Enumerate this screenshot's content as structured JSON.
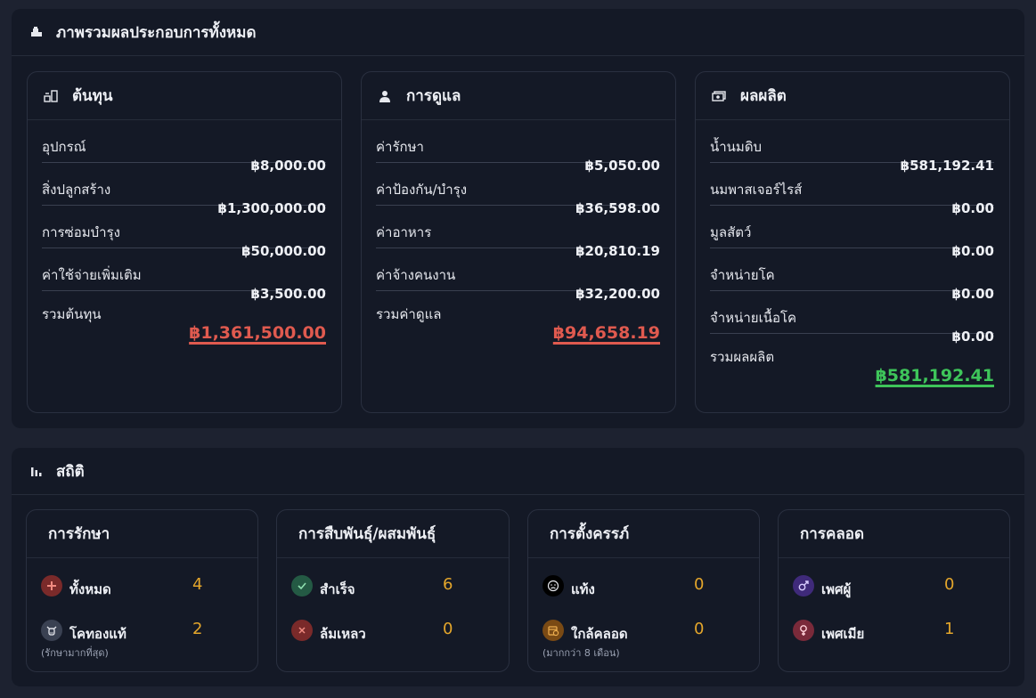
{
  "overview": {
    "title": "ภาพรวมผลประกอบการทั้งหมด",
    "cards": [
      {
        "title": "ต้นทุน",
        "icon": "cash-register-icon",
        "rows": [
          {
            "label": "อุปกรณ์",
            "value": "฿8,000.00"
          },
          {
            "label": "สิ่งปลูกสร้าง",
            "value": "฿1,300,000.00"
          },
          {
            "label": "การซ่อมบำรุง",
            "value": "฿50,000.00"
          },
          {
            "label": "ค่าใช้จ่ายเพิ่มเติม",
            "value": "฿3,500.00"
          }
        ],
        "total_label": "รวมต้นทุน",
        "total_value": "฿1,361,500.00"
      },
      {
        "title": "การดูแล",
        "icon": "user-doctor-icon",
        "rows": [
          {
            "label": "ค่ารักษา",
            "value": "฿5,050.00"
          },
          {
            "label": "ค่าป้องกัน/บำรุง",
            "value": "฿36,598.00"
          },
          {
            "label": "ค่าอาหาร",
            "value": "฿20,810.19"
          },
          {
            "label": "ค่าจ้างคนงาน",
            "value": "฿32,200.00"
          }
        ],
        "total_label": "รวมค่าดูแล",
        "total_value": "฿94,658.19"
      },
      {
        "title": "ผลผลิต",
        "icon": "money-bill-icon",
        "rows": [
          {
            "label": "น้ำนมดิบ",
            "value": "฿581,192.41"
          },
          {
            "label": "นมพาสเจอร์ไรส์",
            "value": "฿0.00"
          },
          {
            "label": "มูลสัตว์",
            "value": "฿0.00"
          },
          {
            "label": "จำหน่ายโค",
            "value": "฿0.00"
          },
          {
            "label": "จำหน่ายเนื้อโค",
            "value": "฿0.00"
          }
        ],
        "total_label": "รวมผลผลิต",
        "total_value": "฿581,192.41"
      }
    ]
  },
  "statistics": {
    "title": "สถิติ",
    "cards": [
      {
        "title": "การรักษา",
        "items": [
          {
            "label": "ทั้งหมด",
            "value": "4",
            "icon": "plus-icon",
            "sub": ""
          },
          {
            "label": "โคทองแท้",
            "value": "2",
            "icon": "cow-icon",
            "sub": "(รักษามากที่สุด)"
          }
        ]
      },
      {
        "title": "การสืบพันธุ์/ผสมพันธุ์",
        "items": [
          {
            "label": "สำเร็จ",
            "value": "6",
            "icon": "check-icon",
            "sub": ""
          },
          {
            "label": "ล้มเหลว",
            "value": "0",
            "icon": "x-icon",
            "sub": ""
          }
        ]
      },
      {
        "title": "การตั้งครรภ์",
        "items": [
          {
            "label": "แท้ง",
            "value": "0",
            "icon": "sad-face-icon",
            "sub": ""
          },
          {
            "label": "ใกล้คลอด",
            "value": "0",
            "icon": "calendar-clock-icon",
            "sub": "(มากกว่า 8 เดือน)"
          }
        ]
      },
      {
        "title": "การคลอด",
        "items": [
          {
            "label": "เพศผู้",
            "value": "0",
            "icon": "male-icon",
            "sub": ""
          },
          {
            "label": "เพศเมีย",
            "value": "1",
            "icon": "female-icon",
            "sub": ""
          }
        ]
      }
    ]
  },
  "colors": {
    "negative": "#e05a4f",
    "positive": "#3ec55a",
    "stat_number": "#e4a62b"
  }
}
